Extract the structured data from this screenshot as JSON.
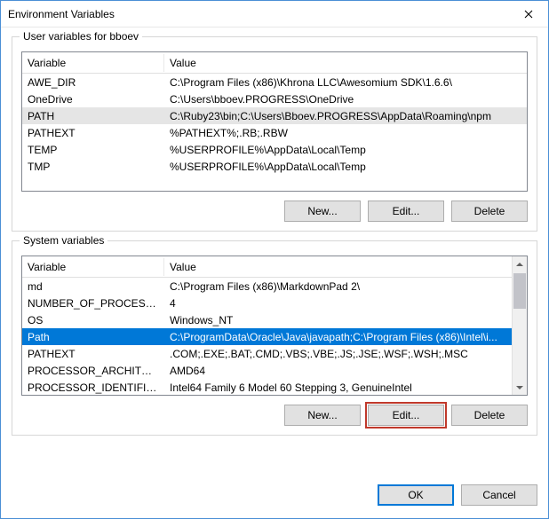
{
  "window": {
    "title": "Environment Variables"
  },
  "userVars": {
    "groupLabel": "User variables for bboev",
    "columns": {
      "variable": "Variable",
      "value": "Value"
    },
    "rows": [
      {
        "name": "AWE_DIR",
        "value": "C:\\Program Files (x86)\\Khrona LLC\\Awesomium SDK\\1.6.6\\"
      },
      {
        "name": "OneDrive",
        "value": "C:\\Users\\bboev.PROGRESS\\OneDrive"
      },
      {
        "name": "PATH",
        "value": "C:\\Ruby23\\bin;C:\\Users\\Bboev.PROGRESS\\AppData\\Roaming\\npm"
      },
      {
        "name": "PATHEXT",
        "value": "%PATHEXT%;.RB;.RBW"
      },
      {
        "name": "TEMP",
        "value": "%USERPROFILE%\\AppData\\Local\\Temp"
      },
      {
        "name": "TMP",
        "value": "%USERPROFILE%\\AppData\\Local\\Temp"
      }
    ],
    "selectedIndex": 2,
    "buttons": {
      "new": "New...",
      "edit": "Edit...",
      "delete": "Delete"
    }
  },
  "systemVars": {
    "groupLabel": "System variables",
    "columns": {
      "variable": "Variable",
      "value": "Value"
    },
    "rows": [
      {
        "name": "md",
        "value": "C:\\Program Files (x86)\\MarkdownPad 2\\"
      },
      {
        "name": "NUMBER_OF_PROCESSORS",
        "value": "4"
      },
      {
        "name": "OS",
        "value": "Windows_NT"
      },
      {
        "name": "Path",
        "value": "C:\\ProgramData\\Oracle\\Java\\javapath;C:\\Program Files (x86)\\Intel\\i..."
      },
      {
        "name": "PATHEXT",
        "value": ".COM;.EXE;.BAT;.CMD;.VBS;.VBE;.JS;.JSE;.WSF;.WSH;.MSC"
      },
      {
        "name": "PROCESSOR_ARCHITECTURE",
        "value": "AMD64"
      },
      {
        "name": "PROCESSOR_IDENTIFIER",
        "value": "Intel64 Family 6 Model 60 Stepping 3, GenuineIntel"
      }
    ],
    "selectedIndex": 3,
    "buttons": {
      "new": "New...",
      "edit": "Edit...",
      "delete": "Delete"
    }
  },
  "dialogButtons": {
    "ok": "OK",
    "cancel": "Cancel"
  }
}
